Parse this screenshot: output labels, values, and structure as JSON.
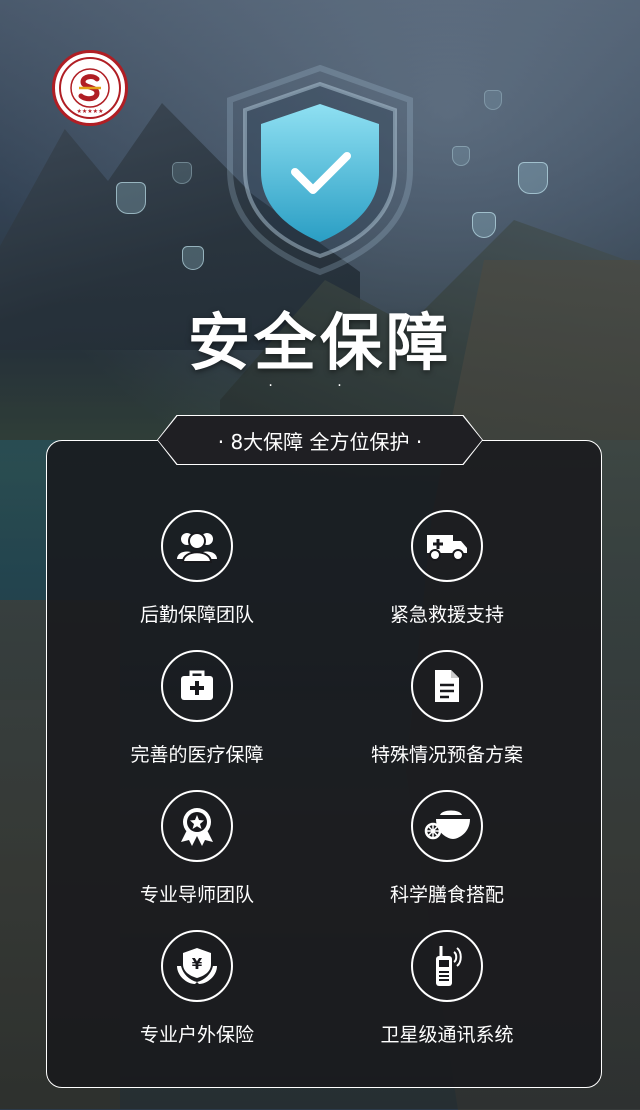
{
  "title": "安全保障",
  "separator": "·  ·",
  "banner": "· 8大保障 全方位保护 ·",
  "features": [
    {
      "label": "后勤保障团队",
      "icon": "team-icon"
    },
    {
      "label": "紧急救援支持",
      "icon": "ambulance-icon"
    },
    {
      "label": "完善的医疗保障",
      "icon": "first-aid-kit-icon"
    },
    {
      "label": "特殊情况预备方案",
      "icon": "document-icon"
    },
    {
      "label": "专业导师团队",
      "icon": "award-badge-icon"
    },
    {
      "label": "科学膳食搭配",
      "icon": "food-bowl-icon"
    },
    {
      "label": "专业户外保险",
      "icon": "insurance-hands-icon"
    },
    {
      "label": "卫星级通讯系统",
      "icon": "walkie-talkie-icon"
    }
  ],
  "colors": {
    "logo_red": "#b01e24",
    "shield_blue": "#3fb8d8",
    "panel_bg": "#18181c"
  }
}
